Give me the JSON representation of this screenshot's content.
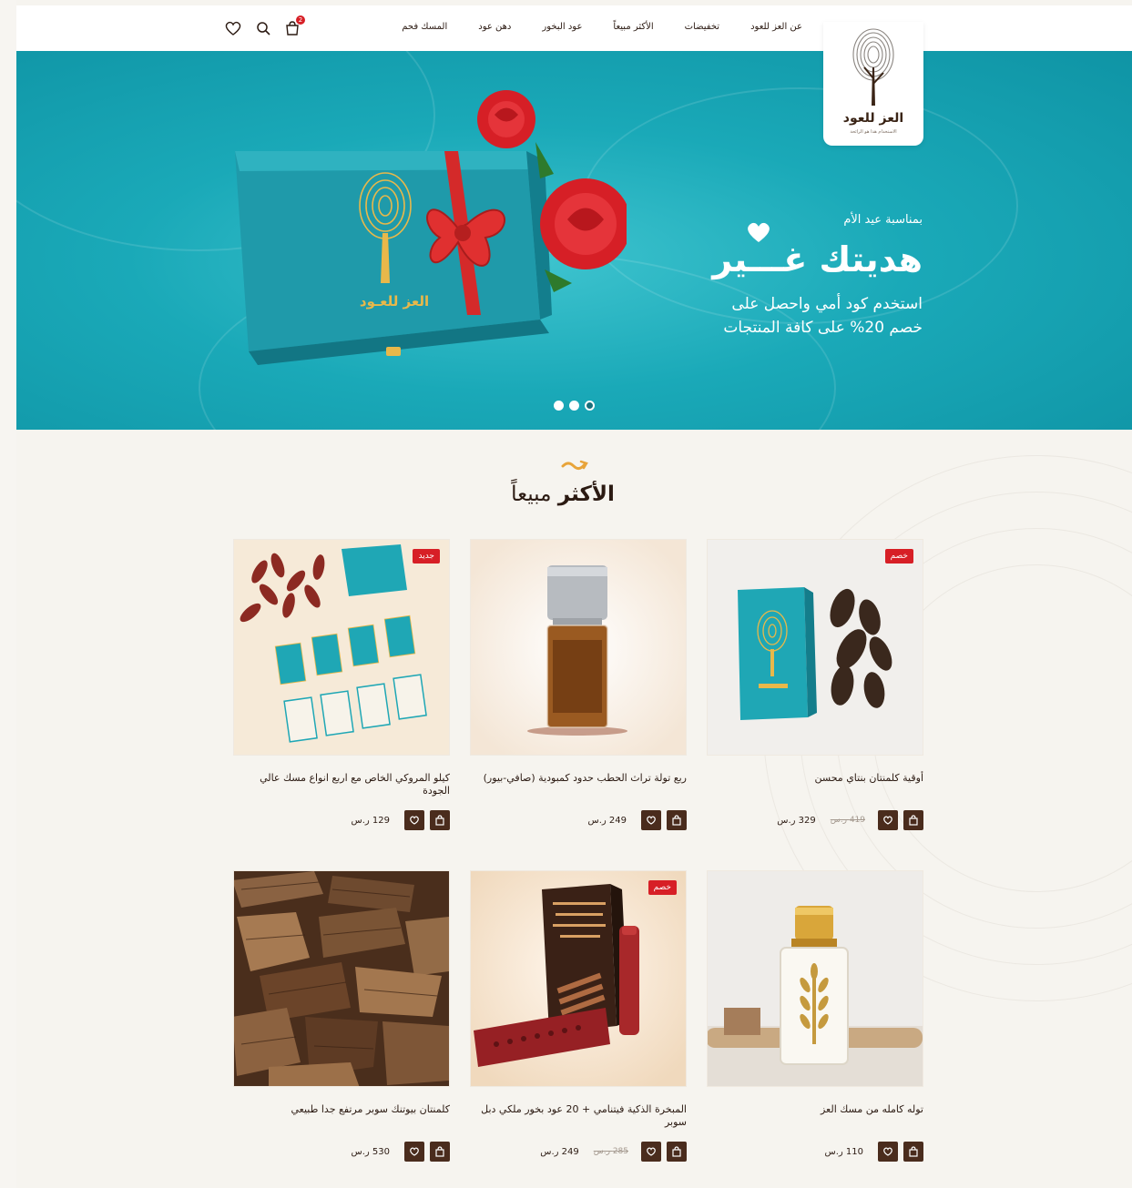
{
  "brand": {
    "name": "العز للعود",
    "tagline": "الاستخدام هذا هو الرائحة"
  },
  "nav": [
    "عن العز للعود",
    "تخفيضات",
    "الأكثر مبيعاً",
    "عود البخور",
    "دهن عود",
    "المسك فحم"
  ],
  "cart": {
    "count": "2"
  },
  "hero": {
    "kicker": "بمناسبة عيد الأم",
    "title": "هديتك غـــير",
    "line1": "استخدم كود أمي واحصل على",
    "line2": "خصم 20% على كافة المنتجات",
    "box_label": "العز للعـود",
    "slides": 3,
    "active_slide": 3
  },
  "section": {
    "title_bold": "الأكثر",
    "title_rest": "مبيعاً"
  },
  "products": [
    {
      "name": "أوقية كلمنتان بنتاي محسن",
      "price": "329 ر.س",
      "old_price": "419 ر.س",
      "tag": "خصم"
    },
    {
      "name": "ربع تولة تراث الحطب حدود كمبودية (صافي-بيور)",
      "price": "249 ر.س",
      "old_price": "",
      "tag": ""
    },
    {
      "name": "كيلو المروكي الخاص مع اربع انواع مسك عالي الجودة",
      "price": "129 ر.س",
      "old_price": "",
      "tag": "جديد"
    },
    {
      "name": "توله كامله من مسك العز",
      "price": "110 ر.س",
      "old_price": "",
      "tag": ""
    },
    {
      "name": "المبخرة الذكية فيتنامي + 20 عود بخور ملكي دبل سوبر",
      "price": "249 ر.س",
      "old_price": "285 ر.س",
      "tag": "خصم"
    },
    {
      "name": "كلمنتان بيوتنك سوبر مرتفع جدا طبيعي",
      "price": "530 ر.س",
      "old_price": "",
      "tag": ""
    }
  ],
  "colors": {
    "teal": "#1aa9b8",
    "brown": "#4a2c1d",
    "red": "#d71f26",
    "gold": "#e8b84a",
    "background": "#f6f4ef"
  },
  "icons": [
    "cart-icon",
    "search-icon",
    "heart-icon"
  ]
}
